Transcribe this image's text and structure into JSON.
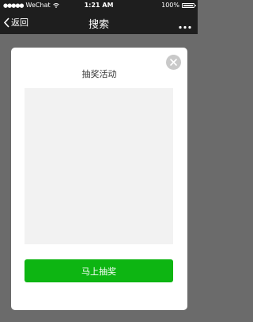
{
  "status_bar": {
    "carrier": "WeChat",
    "time": "1:21 AM",
    "battery_text": "100%",
    "battery_level": 1.0
  },
  "nav": {
    "back_label": "返回",
    "title": "搜索",
    "more_icon": "more-dots-icon"
  },
  "modal": {
    "title": "抽奖活动",
    "close_icon": "close-icon",
    "button_label": "马上抽奖"
  },
  "colors": {
    "nav_background": "#1e1e1e",
    "overlay": "#6b6b6b",
    "button": "#0db512",
    "prize_area": "#f2f2f2"
  }
}
